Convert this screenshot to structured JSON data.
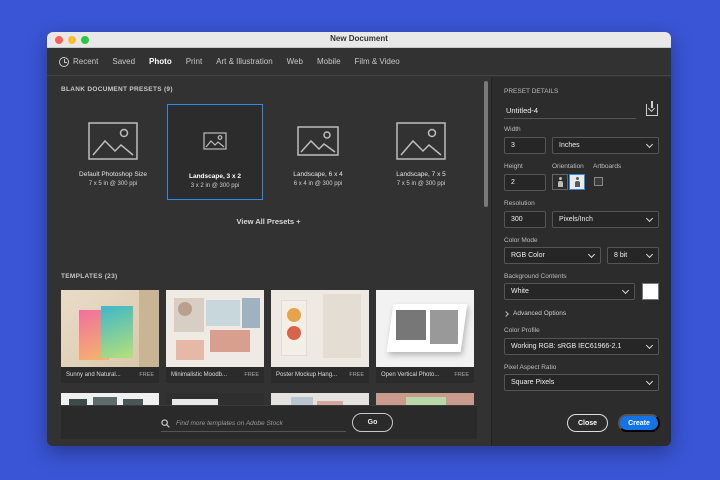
{
  "window": {
    "title": "New Document"
  },
  "tabs": [
    {
      "label": "Recent"
    },
    {
      "label": "Saved"
    },
    {
      "label": "Photo"
    },
    {
      "label": "Print"
    },
    {
      "label": "Art & Illustration"
    },
    {
      "label": "Web"
    },
    {
      "label": "Mobile"
    },
    {
      "label": "Film & Video"
    }
  ],
  "active_tab": "Photo",
  "presets": {
    "heading": "BLANK DOCUMENT PRESETS",
    "count": "(9)",
    "items": [
      {
        "name": "Default Photoshop Size",
        "size": "7 x 5 in @ 300 ppi"
      },
      {
        "name": "Landscape, 3 x 2",
        "size": "3 x 2 in @ 300 ppi"
      },
      {
        "name": "Landscape, 6 x 4",
        "size": "6 x 4 in @ 300 ppi"
      },
      {
        "name": "Landscape, 7 x 5",
        "size": "7 x 5 in @ 300 ppi"
      }
    ],
    "view_all": "View All Presets +"
  },
  "templates": {
    "heading": "TEMPLATES",
    "count": "(23)",
    "items": [
      {
        "name": "Sunny and Natural...",
        "badge": "FREE"
      },
      {
        "name": "Minimalistic Moodb...",
        "badge": "FREE"
      },
      {
        "name": "Poster Mockup Hang...",
        "badge": "FREE"
      },
      {
        "name": "Open Vertical Photo...",
        "badge": "FREE"
      }
    ]
  },
  "search": {
    "placeholder": "Find more templates on Adobe Stock",
    "go_label": "Go"
  },
  "details": {
    "heading": "PRESET DETAILS",
    "doc_name": "Untitled-4",
    "width_label": "Width",
    "width_value": "3",
    "width_unit": "Inches",
    "height_label": "Height",
    "height_value": "2",
    "orientation_label": "Orientation",
    "artboards_label": "Artboards",
    "resolution_label": "Resolution",
    "resolution_value": "300",
    "resolution_unit": "Pixels/Inch",
    "color_mode_label": "Color Mode",
    "color_mode": "RGB Color",
    "bit_depth": "8 bit",
    "background_label": "Background Contents",
    "background": "White",
    "advanced_label": "Advanced Options",
    "color_profile_label": "Color Profile",
    "color_profile": "Working RGB: sRGB IEC61966-2.1",
    "pixel_aspect_label": "Pixel Aspect Ratio",
    "pixel_aspect": "Square Pixels",
    "close_label": "Close",
    "create_label": "Create"
  },
  "colors": {
    "accent": "#1473e6",
    "selection": "#2d8ceb",
    "desktop": "#3a55d6"
  }
}
